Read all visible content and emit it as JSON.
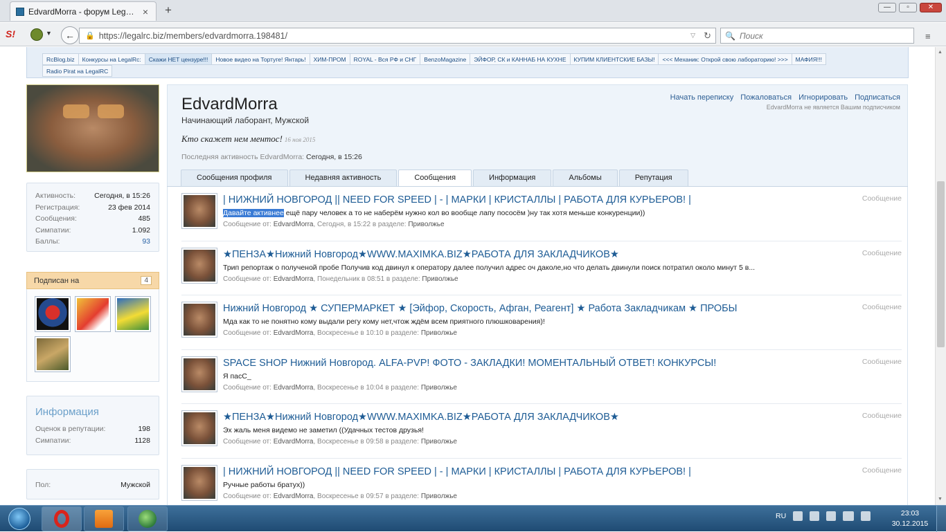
{
  "browser": {
    "tab_title": "EdvardMorra - форум Leg…",
    "url": "https://legalrc.biz/members/edvardmorra.198481/",
    "search_placeholder": "Поиск"
  },
  "links_bar": {
    "row1": [
      "RcBlog.biz",
      "Конкурсы на LegalRc:",
      "Скажи НЕТ цензуре!!!",
      "Новое видео на Тортуге! Янтарь!",
      "ХИМ-ПРОМ",
      "ROYAL - Вся РФ и СНГ",
      "BenzoMagazine",
      "ЭЙФОР, СК и КАННАБ НА КУХНЕ",
      "КУПИМ КЛИЕНТСКИЕ БАЗЫ!",
      "<<< Механик: Открой свою лабораторию! >>>",
      "МАФИЯ!!!"
    ],
    "row2": [
      "Radio Pirat на LegalRC"
    ]
  },
  "profile": {
    "username": "EdvardMorra",
    "title": "Начинающий лаборант, Мужской",
    "status": "Кто скажет нем ментос!",
    "status_date": "16 ноя 2015",
    "last_activity_label": "Последняя активность EdvardMorra:",
    "last_activity_value": "Сегодня, в 15:26",
    "actions": [
      "Начать переписку",
      "Пожаловаться",
      "Игнорировать",
      "Подписаться"
    ],
    "subscription_note": "EdvardMorra не является Вашим подписчиком"
  },
  "stats": [
    {
      "k": "Активность:",
      "v": "Сегодня, в 15:26"
    },
    {
      "k": "Регистрация:",
      "v": "23 фев 2014"
    },
    {
      "k": "Сообщения:",
      "v": "485"
    },
    {
      "k": "Симпатии:",
      "v": "1.092"
    },
    {
      "k": "Баллы:",
      "v": "93"
    }
  ],
  "subscribed": {
    "label": "Подписан на",
    "count": "4"
  },
  "info": {
    "title": "Информация",
    "rows": [
      {
        "k": "Оценок в репутации:",
        "v": "198"
      },
      {
        "k": "Симпатии:",
        "v": "1128"
      }
    ]
  },
  "gender": {
    "k": "Пол:",
    "v": "Мужской"
  },
  "tabs": [
    "Сообщения профиля",
    "Недавняя активность",
    "Сообщения",
    "Информация",
    "Альбомы",
    "Репутация"
  ],
  "results": [
    {
      "title": "| НИЖНИЙ НОВГОРОД || NEED FOR SPEED | - | МАРКИ | КРИСТАЛЛЫ | РАБОТА ДЛЯ КУРЬЕРОВ! |",
      "snip_sel": "Давайте активнее",
      "snip": " ещё пару человек а то не наберём нужно кол во вообще лапу пососём )ну так хотя меньше конкуренции))",
      "meta_pre": "Сообщение от:",
      "author": "EdvardMorra",
      "time": ", Сегодня, в 15:22 в разделе:",
      "section": "Приволжье",
      "type": "Сообщение"
    },
    {
      "title": "★ПЕНЗА★Нижний Новгород★WWW.MAXIMKA.BIZ★РАБОТА ДЛЯ ЗАКЛАДЧИКОВ★",
      "snip_sel": "",
      "snip": "Трип репортаж о полученой пробе Получив код двинул к оператору далее получил адрес оч даколе,но что делать двинули поиск потратил около минут 5 в...",
      "meta_pre": "Сообщение от:",
      "author": "EdvardMorra",
      "time": ", Понедельник в 08:51 в разделе:",
      "section": "Приволжье",
      "type": "Сообщение"
    },
    {
      "title": "Нижний Новгород ★ СУПЕРМАРКЕТ ★ [Эйфор, Скорость, Афган, Реагент] ★ Работа Закладчикам ★ ПРОБЫ",
      "snip_sel": "",
      "snip": "Мда как то не понятно кому выдали регу кому нет,чтож ждём всем приятного плюшковарения)!",
      "meta_pre": "Сообщение от:",
      "author": "EdvardMorra",
      "time": ", Воскресенье в 10:10 в разделе:",
      "section": "Приволжье",
      "type": "Сообщение"
    },
    {
      "title": "SPACE SHOP Нижний Новгород. ALFA-PVP! ФОТО - ЗАКЛАДКИ! МОМЕНТАЛЬНЫЙ ОТВЕТ! КОНКУРСЫ!",
      "snip_sel": "",
      "snip": "Я пасС_",
      "meta_pre": "Сообщение от:",
      "author": "EdvardMorra",
      "time": ", Воскресенье в 10:04 в разделе:",
      "section": "Приволжье",
      "type": "Сообщение"
    },
    {
      "title": "★ПЕНЗА★Нижний Новгород★WWW.MAXIMKA.BIZ★РАБОТА ДЛЯ ЗАКЛАДЧИКОВ★",
      "snip_sel": "",
      "snip": "Эх жаль меня видемо не заметил ((Удачных тестов друзья!",
      "meta_pre": "Сообщение от:",
      "author": "EdvardMorra",
      "time": ", Воскресенье в 09:58 в разделе:",
      "section": "Приволжье",
      "type": "Сообщение"
    },
    {
      "title": "| НИЖНИЙ НОВГОРОД || NEED FOR SPEED | - | МАРКИ | КРИСТАЛЛЫ | РАБОТА ДЛЯ КУРЬЕРОВ! |",
      "snip_sel": "",
      "snip": "Ручные работы братух))",
      "meta_pre": "Сообщение от:",
      "author": "EdvardMorra",
      "time": ", Воскресенье в 09:57 в разделе:",
      "section": "Приволжье",
      "type": "Сообщение"
    }
  ],
  "taskbar": {
    "lang": "RU",
    "time": "23:03",
    "date": "30.12.2015"
  },
  "colors": {
    "link": "#1e5c95",
    "accent": "#2b5d93",
    "subs_header": "#f7d8a8"
  }
}
